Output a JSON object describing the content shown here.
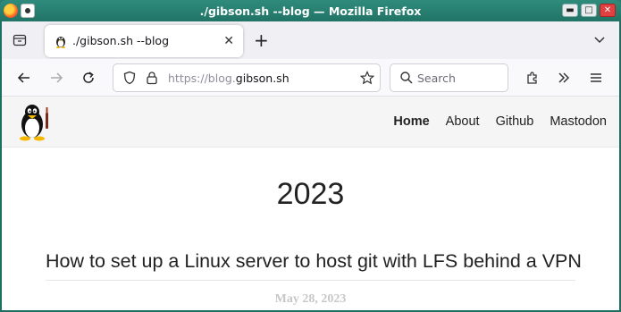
{
  "window": {
    "title": "./gibson.sh --blog — Mozilla Firefox"
  },
  "tabs": [
    {
      "title": "./gibson.sh --blog",
      "favicon": "tux-icon"
    }
  ],
  "navbar": {
    "url_prefix": "https://blog.",
    "url_domain": "gibson.sh",
    "search_placeholder": "Search"
  },
  "site": {
    "nav": [
      {
        "label": "Home",
        "active": true
      },
      {
        "label": "About"
      },
      {
        "label": "Github"
      },
      {
        "label": "Mastodon"
      }
    ]
  },
  "content": {
    "year": "2023",
    "post_title": "How to set up a Linux server to host git with LFS behind a VPN",
    "post_date": "May 28, 2023"
  },
  "colors": {
    "frame": "#1e6e62",
    "toolbar": "#f9f9fb",
    "tabbar": "#f0f0f4",
    "site_header": "#f5f5f5"
  }
}
